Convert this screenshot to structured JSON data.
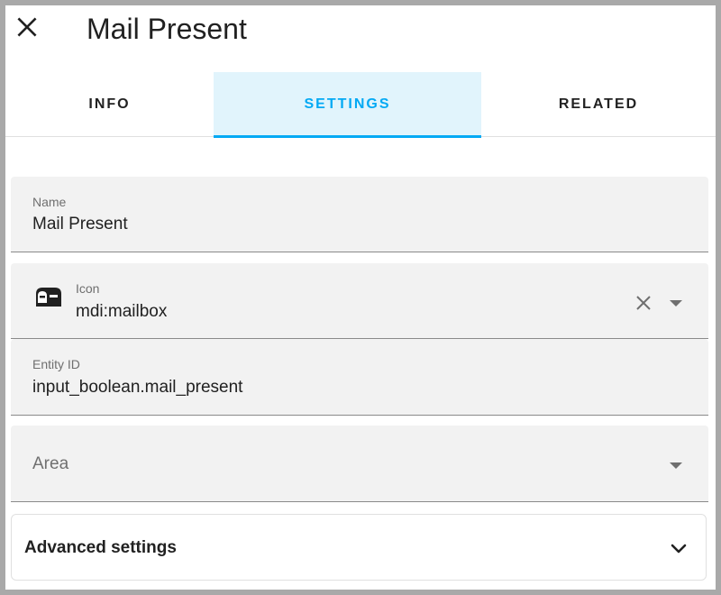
{
  "dialog": {
    "title": "Mail Present"
  },
  "tabs": [
    {
      "label": "INFO",
      "active": false
    },
    {
      "label": "SETTINGS",
      "active": true
    },
    {
      "label": "RELATED",
      "active": false
    }
  ],
  "form": {
    "name": {
      "label": "Name",
      "value": "Mail Present"
    },
    "icon": {
      "label": "Icon",
      "value": "mdi:mailbox",
      "icon": "mailbox-icon"
    },
    "entity_id": {
      "label": "Entity ID",
      "value": "input_boolean.mail_present"
    },
    "area": {
      "placeholder": "Area"
    }
  },
  "advanced": {
    "label": "Advanced settings"
  },
  "colors": {
    "accent": "#03a9f4",
    "active_tab_bg": "#e1f4fc",
    "field_bg": "#f2f2f2"
  }
}
